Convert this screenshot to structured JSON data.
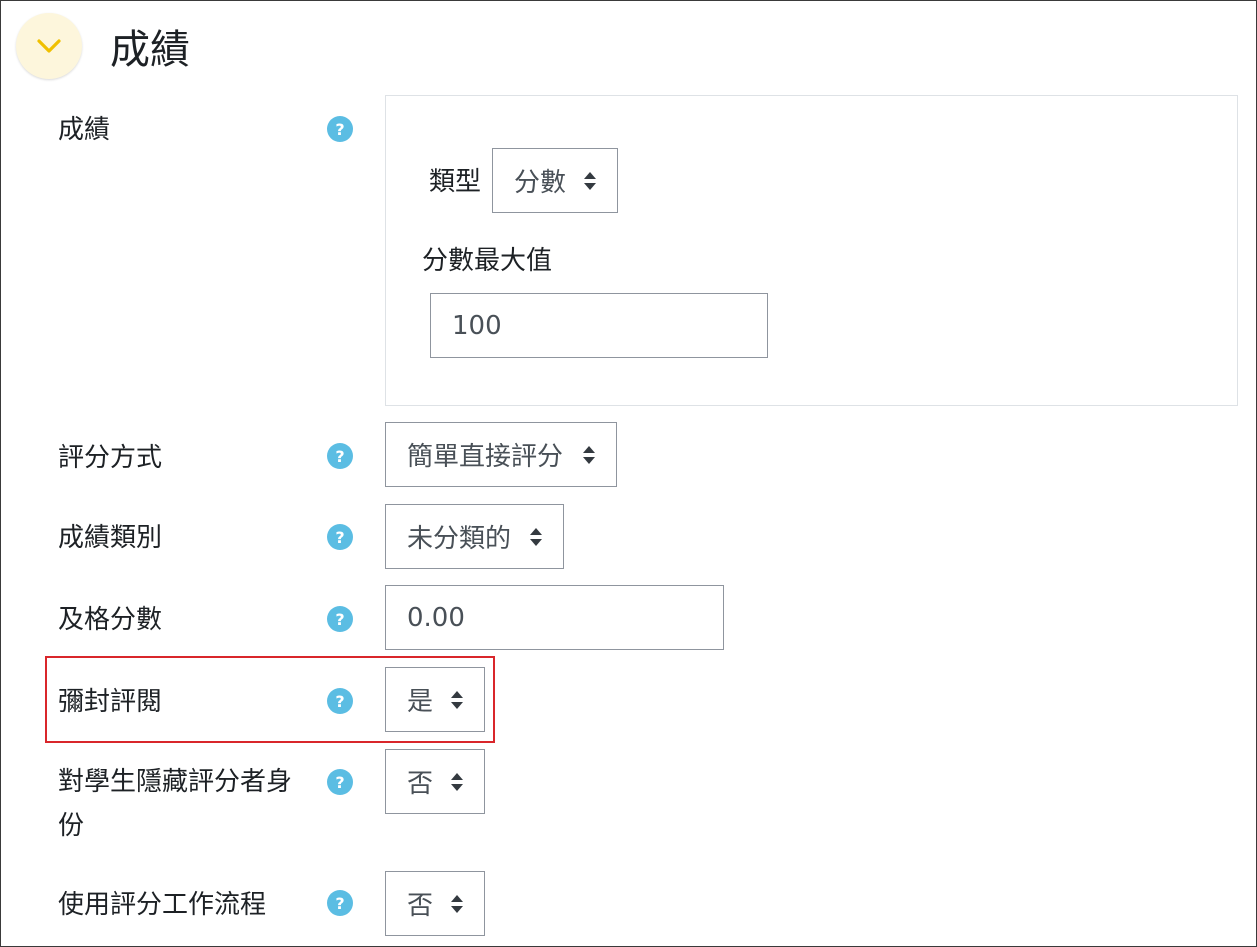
{
  "section": {
    "title": "成績",
    "collapse_icon": "chevron-down-icon",
    "accent_color": "#f0c000"
  },
  "grade": {
    "label": "成績",
    "help": "?",
    "type_label": "類型",
    "type_value": "分數",
    "max_label": "分數最大值",
    "max_value": "100"
  },
  "rows": {
    "grading_method": {
      "label": "評分方式",
      "help": "?",
      "value": "簡單直接評分"
    },
    "grade_category": {
      "label": "成績類別",
      "help": "?",
      "value": "未分類的"
    },
    "grade_to_pass": {
      "label": "及格分數",
      "help": "?",
      "value": "0.00"
    },
    "blind_marking": {
      "label": "彌封評閱",
      "help": "?",
      "value": "是"
    },
    "hide_grader": {
      "label": "對學生隱藏評分者身份",
      "help": "?",
      "value": "否"
    },
    "marking_workflow": {
      "label": "使用評分工作流程",
      "help": "?",
      "value": "否"
    }
  },
  "colors": {
    "help_icon": "#5bbde3",
    "highlight_border": "#d9262b",
    "collapse_bg": "#fdf6dc"
  }
}
